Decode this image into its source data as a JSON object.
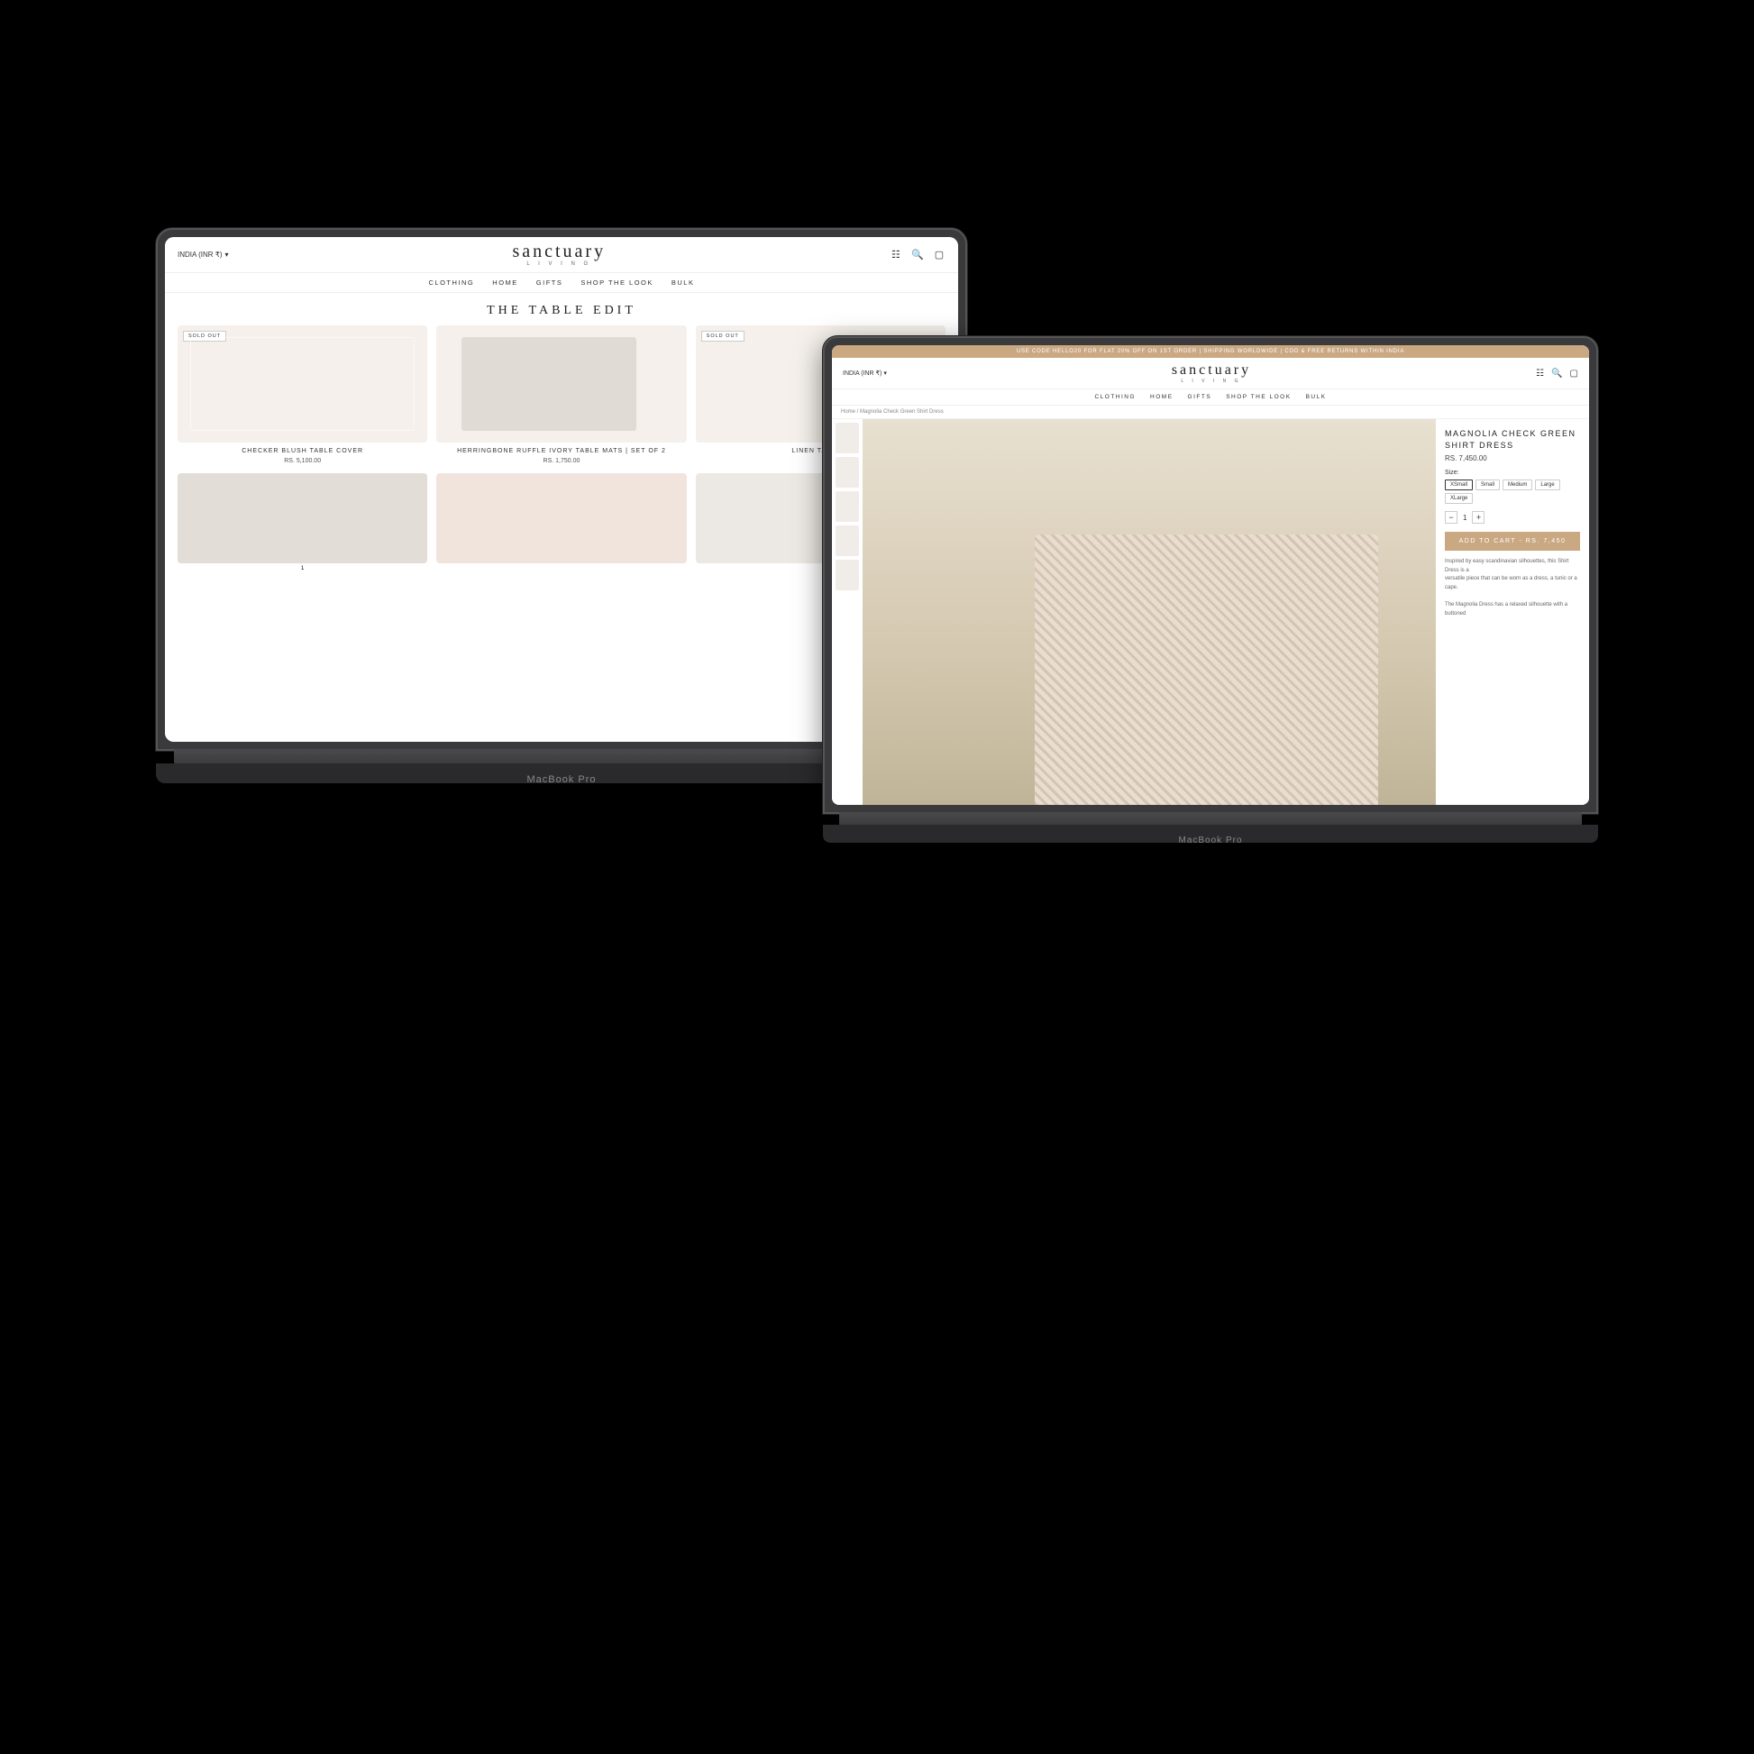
{
  "scene": {
    "background": "#000000"
  },
  "back_laptop": {
    "model_label": "MacBook Pro",
    "screen": {
      "region_selector": "INDIA (INR ₹)",
      "brand_name": "sanctuary",
      "brand_sub": "L I V I N G",
      "nav_items": [
        "CLOTHING",
        "HOME",
        "GIFTS",
        "SHOP THE LOOK",
        "BULK"
      ],
      "page_title": "THE TABLE EDIT",
      "products": [
        {
          "name": "CHECKER BLUSH TABLE COVER",
          "price": "RS. 5,100.00",
          "sold_out": true,
          "image_type": "checker"
        },
        {
          "name": "HERRINGBONE RUFFLE IVORY TABLE MATS | SET OF 2",
          "price": "RS. 1,750.00",
          "sold_out": false,
          "image_type": "herringbone"
        },
        {
          "name": "LINEN TABLE...",
          "price": "",
          "sold_out": false,
          "image_type": "linen"
        },
        {
          "name": "",
          "price": "",
          "sold_out": true,
          "image_type": "sold_out_right"
        },
        {
          "name": "",
          "price": "",
          "sold_out": false,
          "image_type": "small1"
        },
        {
          "name": "",
          "price": "",
          "sold_out": false,
          "image_type": "small2"
        }
      ]
    }
  },
  "front_laptop": {
    "model_label": "MacBook Pro",
    "screen": {
      "announcement_bar": "USE CODE HELLO20 FOR FLAT 20% OFF ON 1ST ORDER | SHIPPING WORLDWIDE | COD & FREE RETURNS WITHIN INDIA",
      "region_selector": "INDIA (INR ₹)",
      "brand_name": "sanctuary",
      "brand_sub": "L I V I N G",
      "nav_items": [
        "CLOTHING",
        "HOME",
        "GIFTS",
        "SHOP THE LOOK",
        "BULK"
      ],
      "breadcrumb": "Home / Magnolia Check Green Shirt Dress",
      "product": {
        "title": "MAGNOLIA CHECK GREEN SHIRT DRESS",
        "price": "RS. 7,450.00",
        "size_label": "Size:",
        "sizes": [
          "XSmall",
          "Small",
          "Medium",
          "Large",
          "XLarge"
        ],
        "selected_size": "XSmall",
        "quantity": "1",
        "add_to_cart_label": "ADD TO CART - RS. 7,450",
        "description_line1": "Inspired by easy scandinavian silhouettes, this Shirt Dress is a",
        "description_line2": "versatile piece that can be worn as a dress, a tunic or a cape.",
        "description_line3": "",
        "description_line4": "The Magnolia Dress has a relaxed silhouette with a buttoned"
      }
    }
  }
}
